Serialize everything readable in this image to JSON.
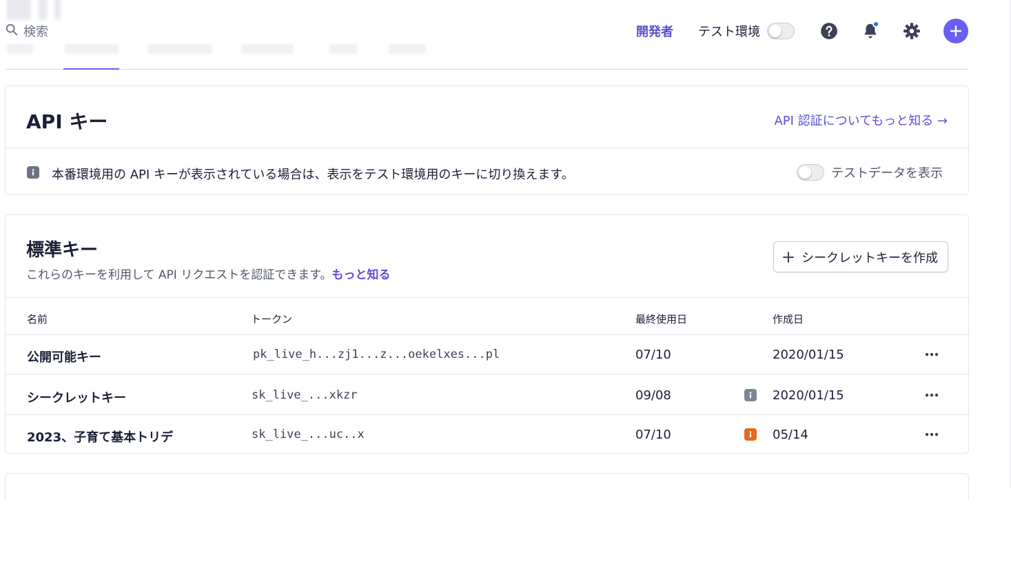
{
  "header": {
    "search_placeholder": "検索",
    "developer_link": "開発者",
    "test_env_label": "テスト環境"
  },
  "api_keys_card": {
    "title": "API キー",
    "learn_link": "API 認証についてもっと知る →",
    "notice": "本番環境用の API キーが表示されている場合は、表示をテスト環境用のキーに切り換えます。",
    "test_data_label": "テストデータを表示"
  },
  "standard_keys": {
    "title": "標準キー",
    "subtitle": "これらのキーを利用して API リクエストを認証できます。",
    "subtitle_link": "もっと知る",
    "create_button": "シークレットキーを作成",
    "columns": {
      "name": "名前",
      "token": "トークン",
      "last_used": "最終使用日",
      "created": "作成日"
    },
    "rows": [
      {
        "name": "公開可能キー",
        "token": "pk_live_h...zj1...z...oekelxes...pl",
        "last_used": "07/10",
        "created": "2020/01/15"
      },
      {
        "name": "シークレットキー",
        "token": "sk_live_...xkzr",
        "last_used": "09/08",
        "created": "2020/01/15"
      },
      {
        "name": "2023、子育て基本トリデ",
        "token": "sk_live_...uc..x",
        "last_used": "07/10",
        "created": "05/14"
      }
    ]
  },
  "colors": {
    "accent": "#6a5ef0",
    "link": "#5b4ed6",
    "info_gray": "#7c8596",
    "info_orange": "#e66a1c"
  },
  "icons": [
    "search-icon",
    "help-icon",
    "bell-icon",
    "gear-icon",
    "plus-icon",
    "info-icon",
    "more-icon"
  ]
}
